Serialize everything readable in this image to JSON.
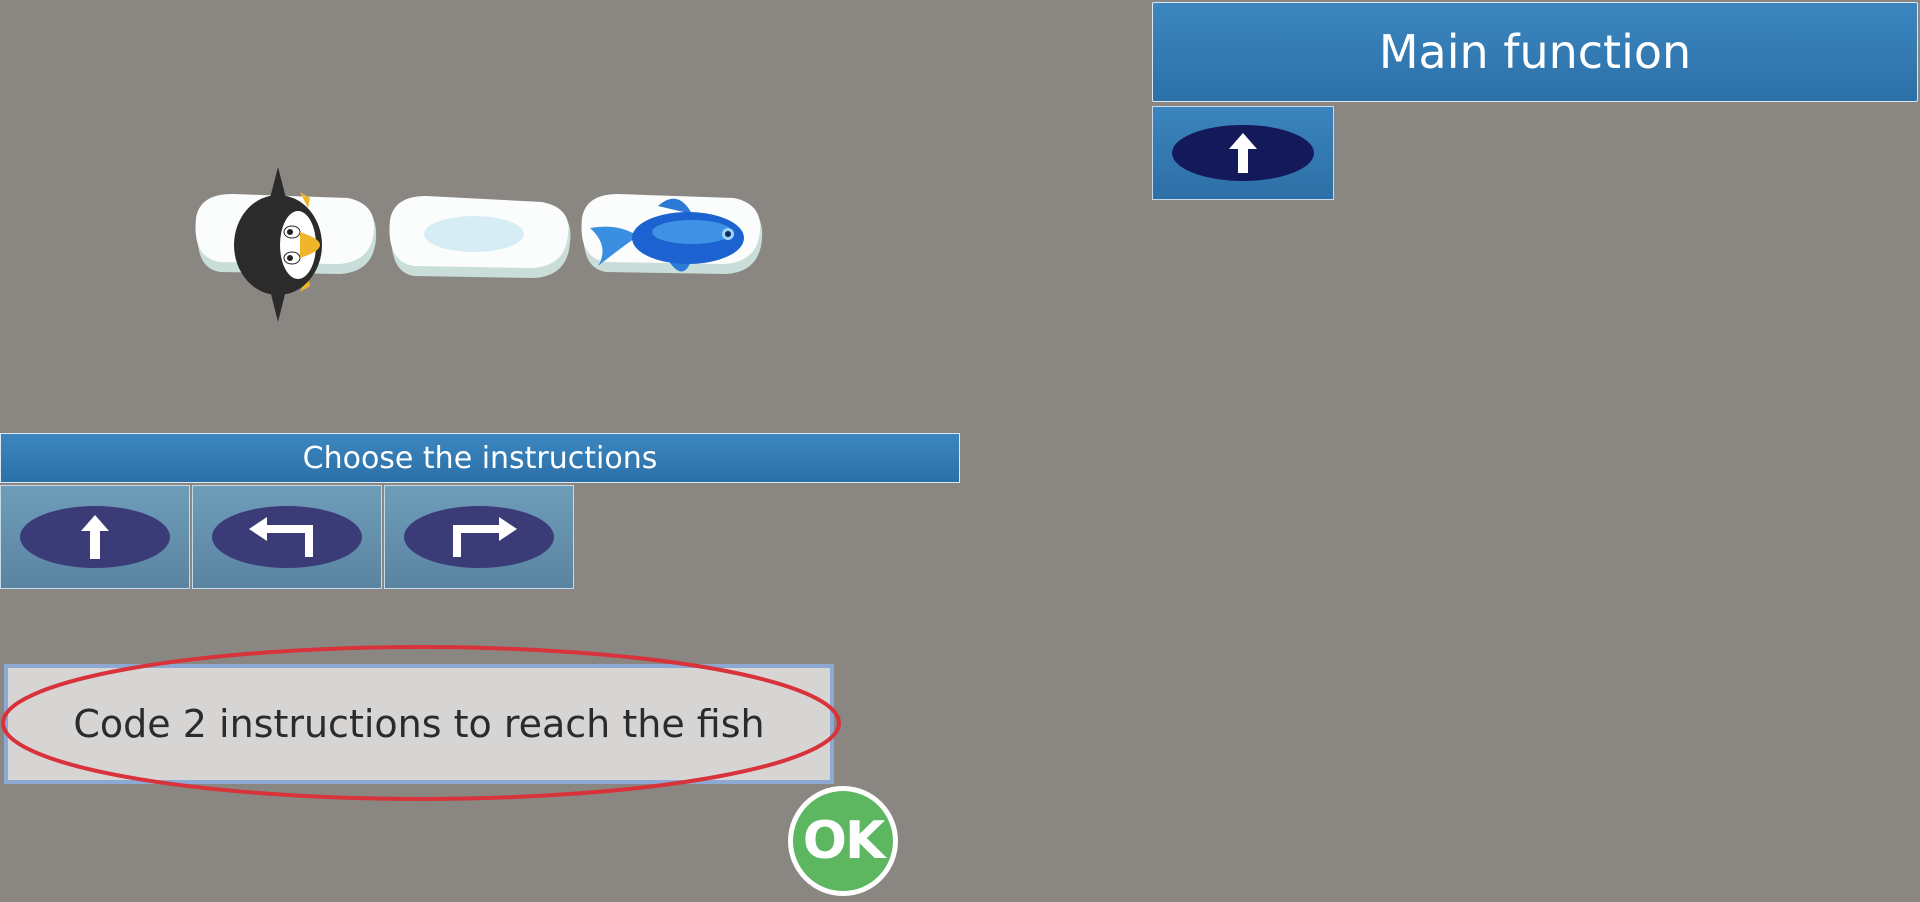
{
  "main_function": {
    "title": "Main function",
    "slots": [
      {
        "instruction": "forward",
        "icon": "arrow-up-icon"
      }
    ]
  },
  "palette": {
    "title": "Choose the instructions",
    "instructions": [
      {
        "instruction": "forward",
        "icon": "arrow-up-icon"
      },
      {
        "instruction": "turn-left",
        "icon": "turn-left-icon"
      },
      {
        "instruction": "turn-right",
        "icon": "turn-right-icon"
      }
    ]
  },
  "board": {
    "tiles": [
      {
        "content": "penguin"
      },
      {
        "content": "empty"
      },
      {
        "content": "fish"
      }
    ]
  },
  "hint": {
    "text": "Code 2 instructions to reach the fish"
  },
  "ok_button": {
    "label": "OK",
    "color": "#5db760"
  },
  "colors": {
    "background": "#8a8782",
    "header_blue": "#2c70a8",
    "highlight_red": "#d8323a"
  }
}
